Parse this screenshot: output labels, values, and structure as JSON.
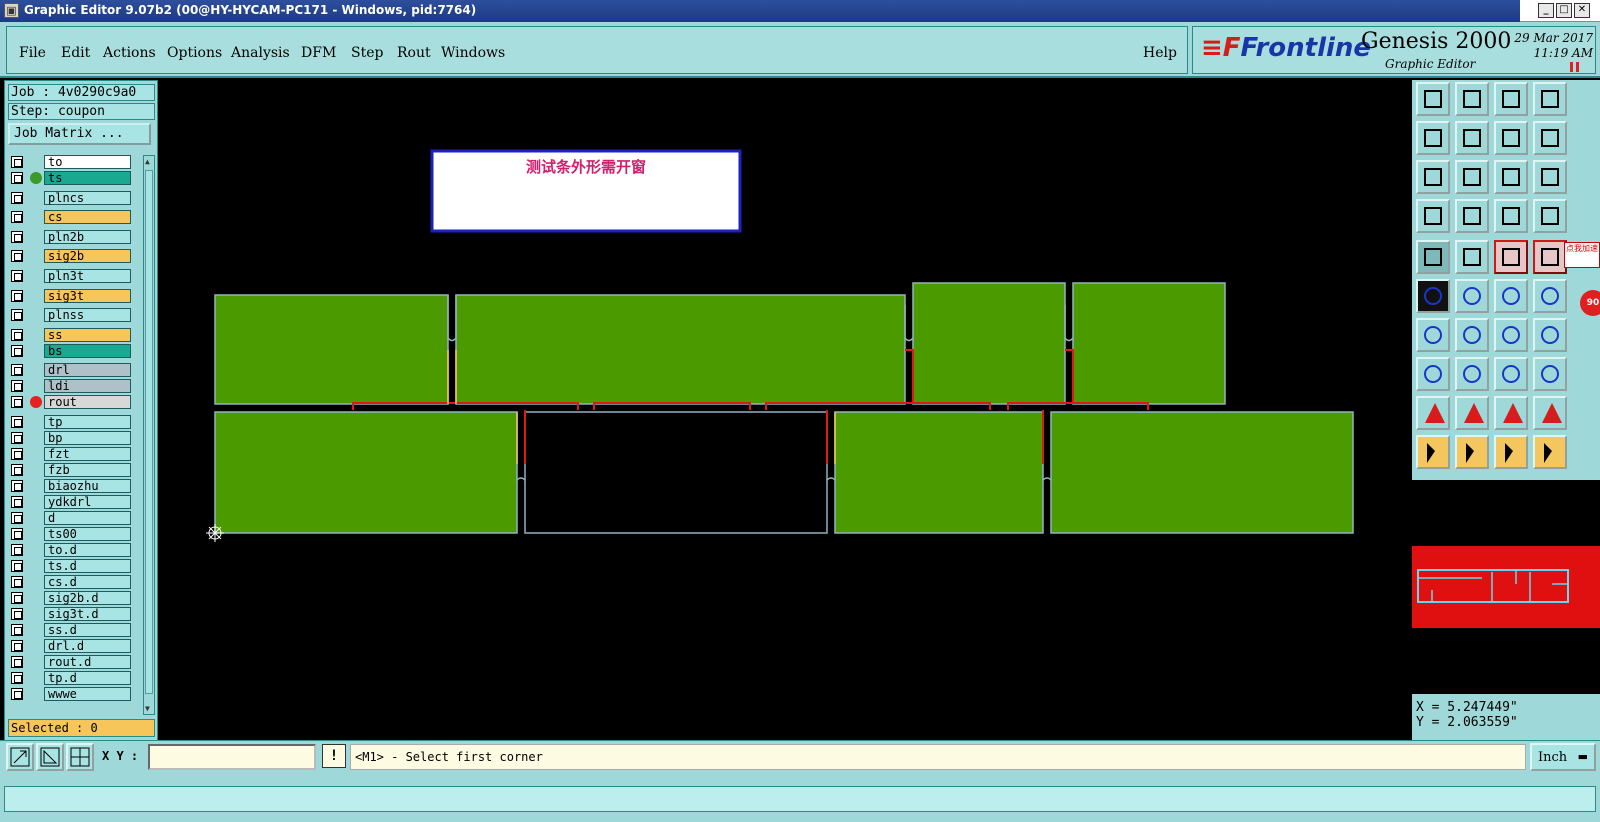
{
  "window": {
    "title": "Graphic Editor 9.07b2 (00@HY-HYCAM-PC171 - Windows, pid:7764)",
    "icon": "app-icon",
    "controls": [
      "minimize",
      "maximize",
      "close"
    ]
  },
  "menu": {
    "items": [
      "File",
      "Edit",
      "Actions",
      "Options",
      "Analysis",
      "DFM",
      "Step",
      "Rout",
      "Windows"
    ],
    "help": "Help"
  },
  "brand": {
    "logo": "Frontline",
    "product": "Genesis 2000",
    "subtitle": "Graphic Editor",
    "date": "29 Mar 2017",
    "time": "11:19 AM"
  },
  "job": {
    "job_label": "Job : 4v0290c9a0",
    "step_label": "Step: coupon",
    "matrix_button": "Job Matrix ..."
  },
  "layers": [
    {
      "name": "to",
      "color": "#ffffff"
    },
    {
      "name": "ts",
      "color": "#1aa890",
      "active": true
    },
    {
      "name": "plncs",
      "color": "#a9e4e4"
    },
    {
      "name": "cs",
      "color": "#f7c65a"
    },
    {
      "name": "pln2b",
      "color": "#a9e4e4"
    },
    {
      "name": "sig2b",
      "color": "#f7c65a"
    },
    {
      "name": "pln3t",
      "color": "#a9e4e4"
    },
    {
      "name": "sig3t",
      "color": "#f7c65a"
    },
    {
      "name": "plnss",
      "color": "#a9e4e4"
    },
    {
      "name": "ss",
      "color": "#f7c65a"
    },
    {
      "name": "bs",
      "color": "#1aa890"
    },
    {
      "name": "drl",
      "color": "#b0c0c8"
    },
    {
      "name": "ldi",
      "color": "#b0c0c8"
    },
    {
      "name": "rout",
      "color": "#d8d8d8",
      "dot": "#e82020"
    },
    {
      "name": "tp",
      "color": "#a9e4e4"
    },
    {
      "name": "bp",
      "color": "#a9e4e4"
    },
    {
      "name": "fzt",
      "color": "#a9e4e4"
    },
    {
      "name": "fzb",
      "color": "#a9e4e4"
    },
    {
      "name": "biaozhu",
      "color": "#a9e4e4"
    },
    {
      "name": "ydkdrl",
      "color": "#a9e4e4"
    },
    {
      "name": "d",
      "color": "#a9e4e4"
    },
    {
      "name": "ts00",
      "color": "#a9e4e4"
    },
    {
      "name": "to.d",
      "color": "#a9e4e4"
    },
    {
      "name": "ts.d",
      "color": "#a9e4e4"
    },
    {
      "name": "cs.d",
      "color": "#a9e4e4"
    },
    {
      "name": "sig2b.d",
      "color": "#a9e4e4"
    },
    {
      "name": "sig3t.d",
      "color": "#a9e4e4"
    },
    {
      "name": "ss.d",
      "color": "#a9e4e4"
    },
    {
      "name": "drl.d",
      "color": "#a9e4e4"
    },
    {
      "name": "rout.d",
      "color": "#a9e4e4"
    },
    {
      "name": "tp.d",
      "color": "#a9e4e4"
    },
    {
      "name": "wwwe",
      "color": "#a9e4e4"
    }
  ],
  "selected": "Selected : 0",
  "canvas": {
    "note_text": "测试条外形需开窗"
  },
  "coordinates": {
    "x": "X = 5.247449\"",
    "y": "Y = 2.063559\""
  },
  "overlay_badge": "点我加速",
  "statusbar": {
    "xy_label": "X Y :",
    "xy_value": "",
    "prompt_icon": "!",
    "prompt": "<M1> - Select first corner",
    "unit": "Inch"
  },
  "colors": {
    "panel": "#9ed8d8",
    "board_fill": "#4a9a00",
    "rout_line": "#e01818",
    "outline": "#8fb4c4",
    "signal": "#f7c65a"
  }
}
